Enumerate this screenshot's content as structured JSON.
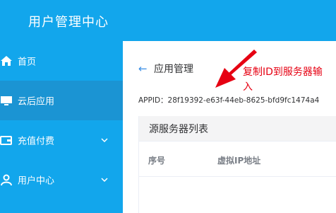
{
  "header": {
    "title": "用户管理中心"
  },
  "sidebar": {
    "items": [
      {
        "label": "首页",
        "icon": "home-icon",
        "active": false
      },
      {
        "label": "云后应用",
        "icon": "monitor-icon",
        "active": true
      },
      {
        "label": "充值付费",
        "icon": "wallet-icon",
        "active": false,
        "expandable": true
      },
      {
        "label": "用户中心",
        "icon": "user-icon",
        "active": false,
        "expandable": true
      }
    ]
  },
  "main": {
    "breadcrumb": {
      "back_icon": "←",
      "label": "应用管理"
    },
    "annotation": {
      "text": "复制ID到服务器输入"
    },
    "appid": "APPID：28f19392-e63f-44eb-8625-bfd9fc1474a4",
    "server_panel": {
      "title": "源服务器列表",
      "columns": [
        "序号",
        "虚拟IP地址"
      ]
    }
  },
  "colors": {
    "primary": "#12a6ec",
    "active_item": "#1b94d3",
    "annotation": "#e60012",
    "link": "#3a8ee6"
  }
}
